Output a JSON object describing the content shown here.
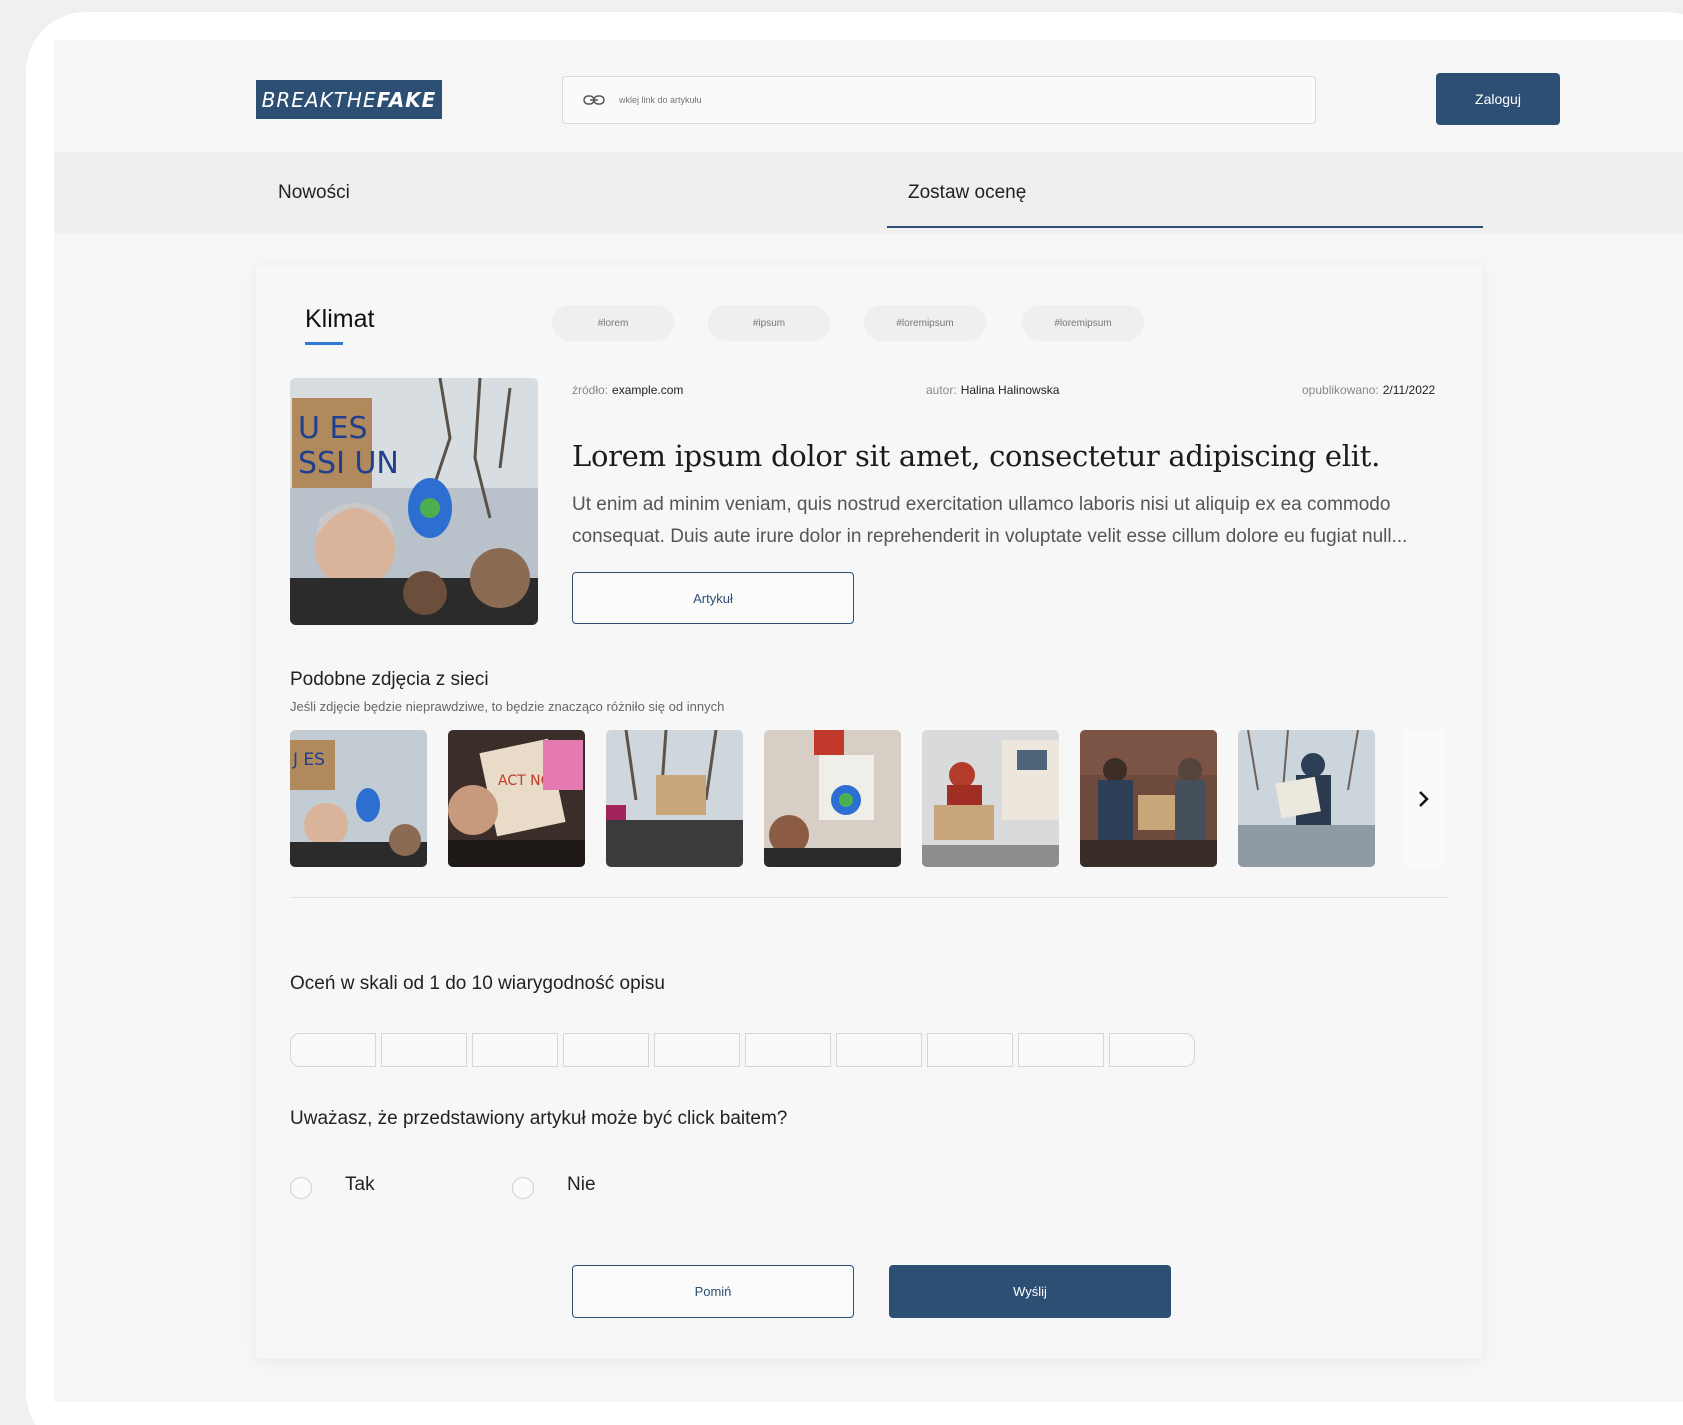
{
  "header": {
    "logo_text_light": "BREAKTHE",
    "logo_text_bold": "FAKE",
    "search_placeholder": "wklej link do artykułu",
    "login_label": "Zaloguj"
  },
  "nav": {
    "items": [
      {
        "label": "Nowości",
        "active": false
      },
      {
        "label": "Zostaw ocenę",
        "active": true
      }
    ]
  },
  "article": {
    "category": "Klimat",
    "tags": [
      "#lorem",
      "#ipsum",
      "#loremipsum",
      "#loremipsum"
    ],
    "source_label": "źródło:",
    "source_value": "example.com",
    "author_label": "autor:",
    "author_value": "Halina Halinowska",
    "published_label": "opublikowano:",
    "published_value": "2/11/2022",
    "title": "Lorem ipsum dolor sit amet, consectetur adipiscing elit.",
    "description": "Ut enim ad minim veniam, quis nostrud exercitation ullamco laboris nisi ut aliquip ex ea commodo consequat. Duis aute irure dolor in reprehenderit in voluptate velit esse cillum dolore eu fugiat null...",
    "button_label": "Artykuł"
  },
  "similar": {
    "title": "Podobne zdjęcia z sieci",
    "subtitle": "Jeśli zdjęcie będzie nieprawdziwe, to będzie znacząco różniło się od innych",
    "thumbnail_count": 7
  },
  "rating": {
    "question": "Oceń w skali od 1 do 10 wiarygodność opisu",
    "scale_max": 10
  },
  "clickbait": {
    "question": "Uważasz, że przedstawiony artykuł może być click baitem?",
    "options": [
      "Tak",
      "Nie"
    ]
  },
  "actions": {
    "skip_label": "Pomiń",
    "send_label": "Wyślij"
  },
  "colors": {
    "primary": "#2d4f74",
    "accent": "#2f7bd4"
  }
}
